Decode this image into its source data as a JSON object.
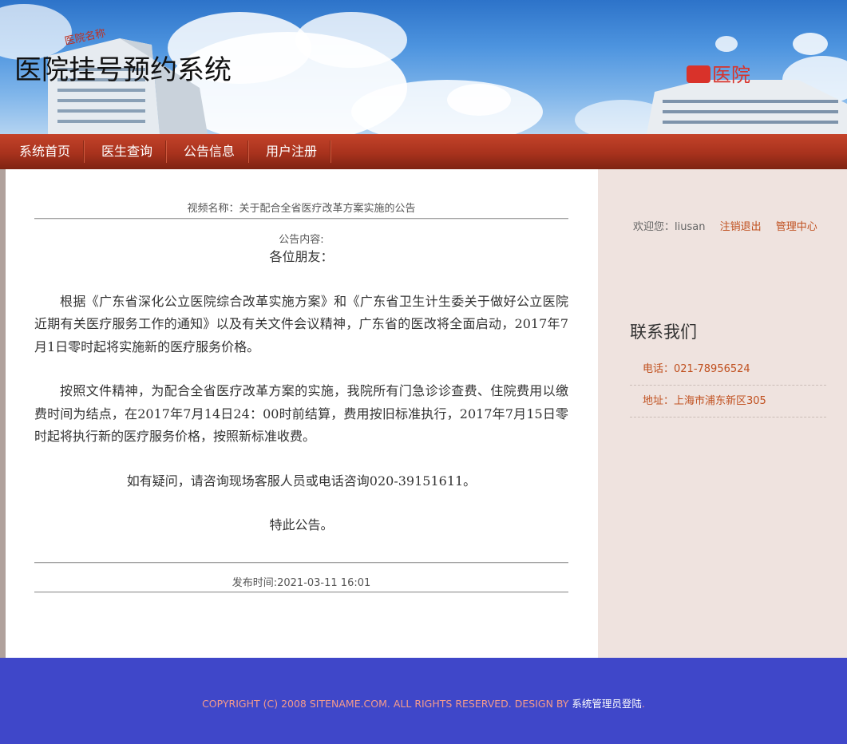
{
  "header": {
    "site_title": "医院挂号预约系统",
    "hospital_sign_left": "医院名称",
    "hospital_sign_right": "医院"
  },
  "nav": {
    "items": [
      {
        "label": "系统首页"
      },
      {
        "label": "医生查询"
      },
      {
        "label": "公告信息"
      },
      {
        "label": "用户注册"
      }
    ]
  },
  "article": {
    "video_name_label": "视频名称：",
    "video_name": "关于配合全省医疗改革方案实施的公告",
    "notice_label": "公告内容:",
    "greeting": "各位朋友：",
    "paragraph1": "根据《广东省深化公立医院综合改革实施方案》和《广东省卫生计生委关于做好公立医院近期有关医疗服务工作的通知》以及有关文件会议精神，广东省的医改将全面启动，2017年7月1日零时起将实施新的医疗服务价格。",
    "paragraph2": "按照文件精神，为配合全省医疗改革方案的实施，我院所有门急诊诊查费、住院费用以缴费时间为结点，在2017年7月14日24：00时前结算，费用按旧标准执行，2017年7月15日零时起将执行新的医疗服务价格，按照新标准收费。",
    "paragraph3": "如有疑问，请咨询现场客服人员或电话咨询020-39151611。",
    "closing": "特此公告。",
    "publish_label": "发布时间:",
    "publish_time": "2021-03-11 16:01"
  },
  "sidebar": {
    "welcome_label": "欢迎您：",
    "username": "liusan",
    "logout_link": "注销退出",
    "admin_center_link": "管理中心",
    "contact_title": "联系我们",
    "phone": "电话：021-78956524",
    "address": "地址：上海市浦东新区305"
  },
  "footer": {
    "copyright": "COPYRIGHT (C) 2008 SITENAME.COM. ALL RIGHTS RESERVED. DESIGN BY ",
    "admin_login_link": "系统管理员登陆",
    "trailing": "."
  },
  "colors": {
    "nav_red": "#a8321d",
    "link_orange": "#c0501f",
    "sidebar_bg": "#efe3df",
    "footer_blue": "#3f47c9",
    "footer_text": "#f39a8c"
  }
}
